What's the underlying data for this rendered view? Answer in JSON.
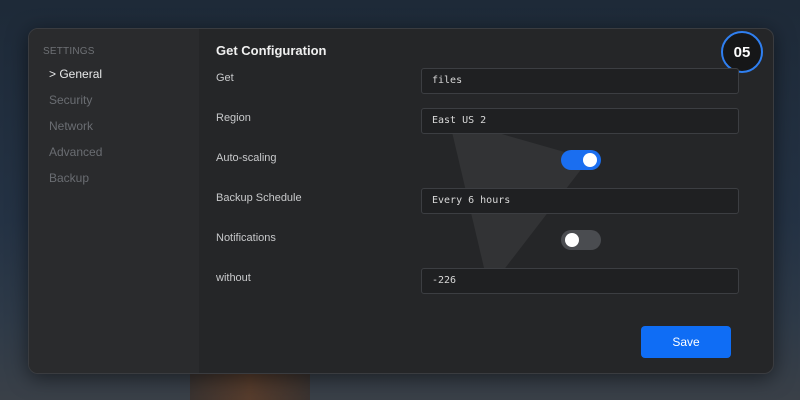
{
  "sidebar": {
    "heading": "SETTINGS",
    "items": [
      {
        "label": "> General",
        "active": true
      },
      {
        "label": "Security",
        "active": false
      },
      {
        "label": "Network",
        "active": false
      },
      {
        "label": "Advanced",
        "active": false
      },
      {
        "label": "Backup",
        "active": false
      }
    ]
  },
  "main": {
    "title": "Get Configuration",
    "step_badge": "05",
    "rows": [
      {
        "label": "Get",
        "type": "input",
        "value": "files"
      },
      {
        "label": "Region",
        "type": "input",
        "value": "East US 2"
      },
      {
        "label": "Auto-scaling",
        "type": "toggle",
        "value": "on"
      },
      {
        "label": "Backup Schedule",
        "type": "input",
        "value": "Every 6 hours"
      },
      {
        "label": "Notifications",
        "type": "toggle",
        "value": "off"
      },
      {
        "label": "without",
        "type": "input",
        "value": "-226"
      }
    ],
    "save_label": "Save"
  },
  "colors": {
    "accent": "#1a6ef0",
    "save_button": "#0f6df5",
    "badge_ring": "#2f7ff0"
  }
}
